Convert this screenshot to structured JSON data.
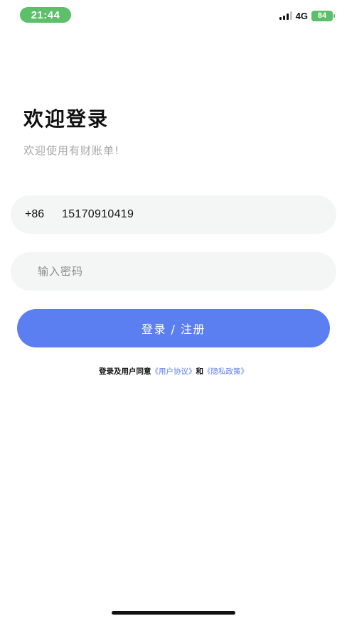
{
  "status_bar": {
    "time": "21:44",
    "network": "4G",
    "battery": "84"
  },
  "header": {
    "title": "欢迎登录",
    "subtitle": "欢迎使用有财账单!"
  },
  "form": {
    "country_code": "+86",
    "phone_value": "15170910419",
    "password_placeholder": "输入密码",
    "submit_label": "登录 / 注册"
  },
  "agreement": {
    "prefix": "登录及用户同意",
    "user_agreement_link": "《用户协议》",
    "conjunction": "和",
    "privacy_policy_link": "《隐私政策》"
  },
  "colors": {
    "accent": "#5b7ef0",
    "status_green": "#5cbf6a",
    "field_bg": "#f4f5f5",
    "subtitle_gray": "#a8a8a8"
  }
}
